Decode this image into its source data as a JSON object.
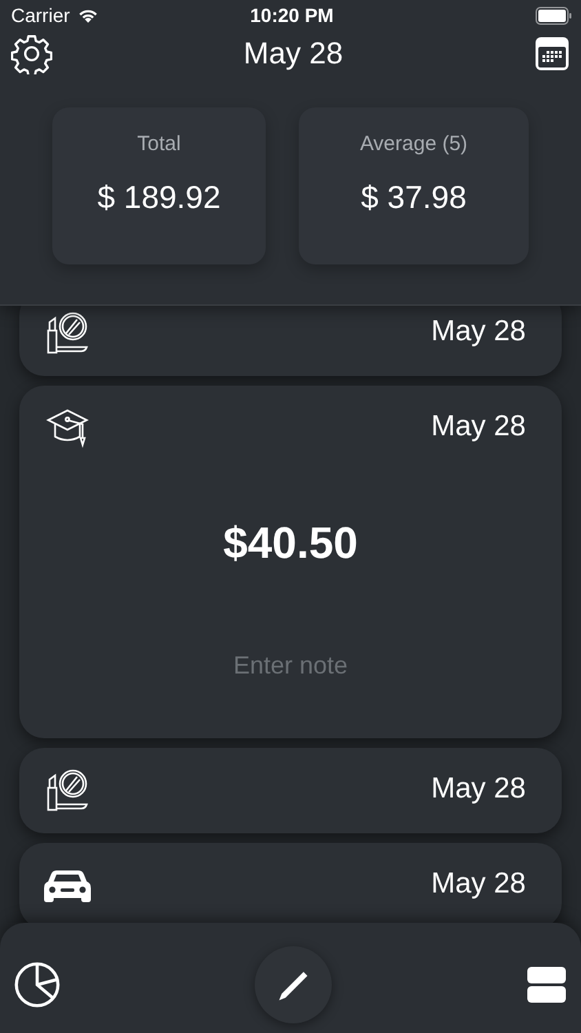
{
  "status_bar": {
    "carrier": "Carrier",
    "time": "10:20 PM"
  },
  "header": {
    "title": "May 28"
  },
  "summary": [
    {
      "label": "Total",
      "value": "$ 189.92"
    },
    {
      "label": "Average (5)",
      "value": "$ 37.98"
    }
  ],
  "entries": [
    {
      "kind": "cosmetics",
      "date": "May 28",
      "expanded": false
    },
    {
      "kind": "education",
      "date": "May 28",
      "expanded": true,
      "amount": "$40.50",
      "note_placeholder": "Enter note"
    },
    {
      "kind": "cosmetics",
      "date": "May 28",
      "expanded": false
    },
    {
      "kind": "car",
      "date": "May 28",
      "expanded": false
    }
  ]
}
